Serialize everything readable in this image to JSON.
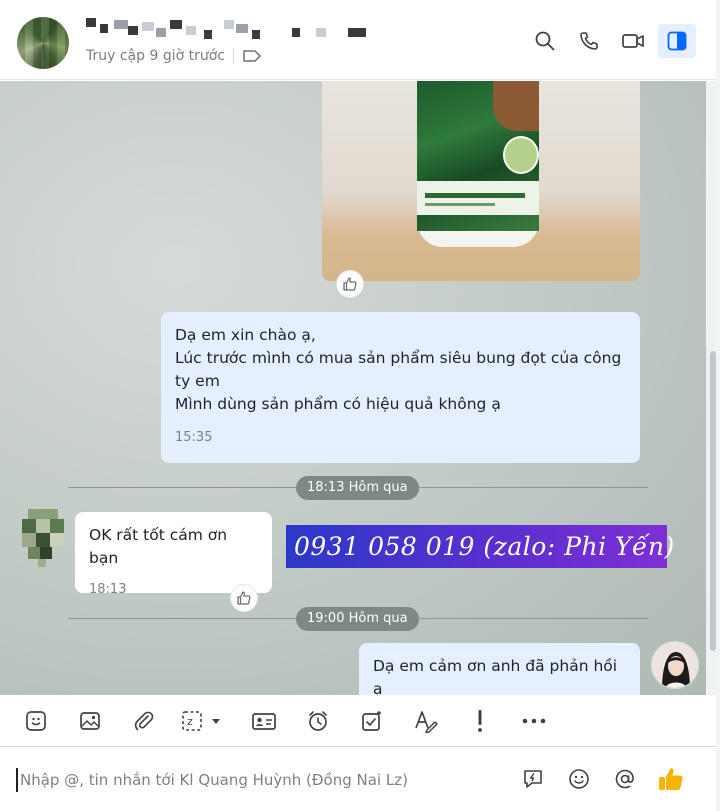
{
  "header": {
    "last_seen": "Truy cập 9 giờ trước",
    "icons": [
      "search-icon",
      "phone-icon",
      "video-call-icon",
      "sidebar-toggle-icon"
    ],
    "active_color": "#0068ff"
  },
  "messages": [
    {
      "from": "me",
      "lines": [
        "Dạ em xin chào ạ,",
        "Lúc trước mình có mua sản phẩm siêu bung đọt của công",
        "ty em",
        "Mình dùng sản phẩm có hiệu quả không ạ"
      ],
      "time": "15:35"
    },
    {
      "from": "them",
      "text": "OK rất tốt cám ơn bạn",
      "time": "18:13"
    },
    {
      "from": "me",
      "text": "Dạ em cảm ơn anh đã phản hồi ạ"
    }
  ],
  "dividers": [
    "18:13 Hôm qua",
    "19:00 Hôm qua"
  ],
  "promo_text": "0931 058 019 (zalo: Phi Yến)",
  "toolbar": {
    "tools": [
      "sticker-icon",
      "image-icon",
      "attachment-icon",
      "screenshot-icon",
      "contact-card-icon",
      "reminder-icon",
      "task-icon",
      "format-text-icon",
      "urgent-icon",
      "more-icon"
    ]
  },
  "composer": {
    "placeholder": "Nhập @, tin nhắn tới Kl Quang Huỳnh (Đồng Nai Lz)",
    "icons": [
      "quick-message-icon",
      "emoji-icon",
      "mention-icon",
      "thumbs-up-icon"
    ]
  },
  "colors": {
    "my_bubble": "#e5efff",
    "their_bubble": "#ffffff",
    "promo_start": "#2c39c8",
    "promo_end": "#7e2fd4",
    "thumbs_up": "#f5b400"
  }
}
